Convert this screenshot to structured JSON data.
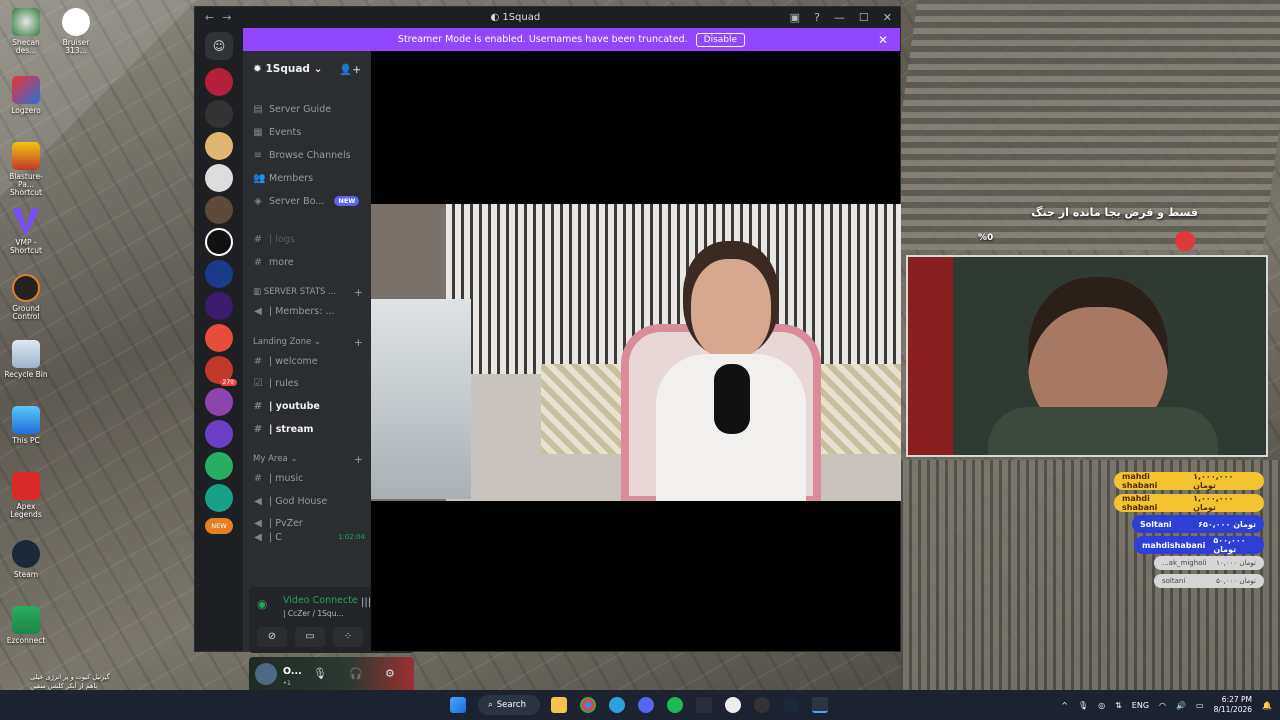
{
  "desktop": {
    "icons": [
      {
        "label": "Shecan des..."
      },
      {
        "label": "Bruiser 313..."
      },
      {
        "label": "Logzero"
      },
      {
        "label": "Blasture-Pa... Shortcut"
      },
      {
        "label": "VMP - Shortcut"
      },
      {
        "label": "Ground Control"
      },
      {
        "label": "Recycle Bin"
      },
      {
        "label": "This PC"
      },
      {
        "label": "Apex Legends"
      },
      {
        "label": "Steam"
      },
      {
        "label": "Ezconnect"
      }
    ]
  },
  "discord": {
    "window_title": "1Squad",
    "banner": {
      "text": "Streamer Mode is enabled. Usernames have been truncated.",
      "disable_label": "Disable"
    },
    "server_name": "1Squad",
    "server_badge_new": "NEW",
    "server_badge_count": "279",
    "menu": [
      {
        "label": "Server Guide"
      },
      {
        "label": "Events"
      },
      {
        "label": "Browse Channels"
      },
      {
        "label": "Members"
      },
      {
        "label": "Server Bo...",
        "badge": "NEW"
      }
    ],
    "channels_top": [
      {
        "label": "| logs"
      },
      {
        "label": "more"
      }
    ],
    "stats_category": "SERVER STATS ...",
    "stats_channel": "| Members: ...",
    "landing_category": "Landing Zone",
    "landing_channels": [
      {
        "label": "| welcome"
      },
      {
        "label": "| rules"
      },
      {
        "label": "| youtube"
      },
      {
        "label": "| stream"
      }
    ],
    "myarea_category": "My Area",
    "myarea_channels": [
      {
        "label": "| music"
      },
      {
        "label": "| God House"
      },
      {
        "label": "| PvZer"
      },
      {
        "label": "| C",
        "time": "1:02:04"
      }
    ],
    "voice": {
      "status": "Video Connecte",
      "location": "| CcZer / 1Squ..."
    },
    "user": {
      "name": "O...",
      "status": "•1"
    }
  },
  "overlay": {
    "title": "قسط و قرض بجا مانده از جنگ",
    "percent": "%0",
    "donations": [
      {
        "name": "mahdi shabani",
        "amount": "۱,۰۰۰,۰۰۰ تومان",
        "style": "gold"
      },
      {
        "name": "mahdi shabani",
        "amount": "۱,۰۰۰,۰۰۰ تومان",
        "style": "gold"
      },
      {
        "name": "Soltani",
        "amount": "۶۵۰,۰۰۰ تومان",
        "style": "blue"
      },
      {
        "name": "mahdishabani",
        "amount": "۵۰۰,۰۰۰ تومان",
        "style": "blue"
      },
      {
        "name": "...ak_migholi",
        "amount": "۱۰,۰۰۰ تومان",
        "style": "gray"
      },
      {
        "name": "soltani",
        "amount": "۵۰,۰۰۰ تومان",
        "style": "gray"
      }
    ],
    "sticker_line1": "گیرنیل کیوت و پر انرژی خیلی",
    "sticker_line2": "باهم از آنکر کلشن سفین"
  },
  "taskbar": {
    "search_label": "Search",
    "lang": "ENG",
    "time": "6:27 PM",
    "date": "8/11/2026"
  },
  "colors": {
    "streamer_banner": "#9146ff",
    "donation_gold": "#f4c430",
    "donation_blue": "#2c3fd6",
    "voice_connected": "#23a55a"
  }
}
